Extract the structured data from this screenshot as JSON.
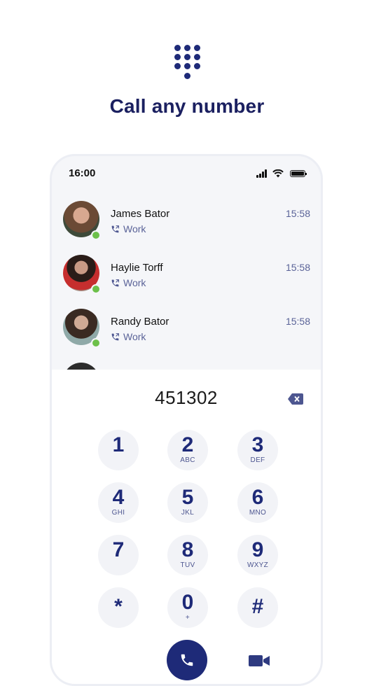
{
  "headline": "Call any number",
  "status_bar": {
    "time": "16:00"
  },
  "recents": [
    {
      "name": "James Bator",
      "type": "Work",
      "time": "15:58"
    },
    {
      "name": "Haylie Torff",
      "type": "Work",
      "time": "15:58"
    },
    {
      "name": "Randy Bator",
      "type": "Work",
      "time": "15:58"
    }
  ],
  "dialer": {
    "number": "451302",
    "keys": [
      {
        "digit": "1",
        "letters": ""
      },
      {
        "digit": "2",
        "letters": "ABC"
      },
      {
        "digit": "3",
        "letters": "DEF"
      },
      {
        "digit": "4",
        "letters": "GHI"
      },
      {
        "digit": "5",
        "letters": "JKL"
      },
      {
        "digit": "6",
        "letters": "MNO"
      },
      {
        "digit": "7",
        "letters": ""
      },
      {
        "digit": "8",
        "letters": "TUV"
      },
      {
        "digit": "9",
        "letters": "WXYZ"
      },
      {
        "digit": "*",
        "letters": ""
      },
      {
        "digit": "0",
        "letters": "+"
      },
      {
        "digit": "#",
        "letters": ""
      }
    ]
  },
  "icons": [
    "dialpad-icon",
    "phone-icon",
    "video-icon",
    "backspace-icon",
    "outgoing-call-icon"
  ],
  "colors": {
    "accent": "#1e2a78",
    "online": "#6cc04a",
    "muted_text": "#5a6398"
  }
}
